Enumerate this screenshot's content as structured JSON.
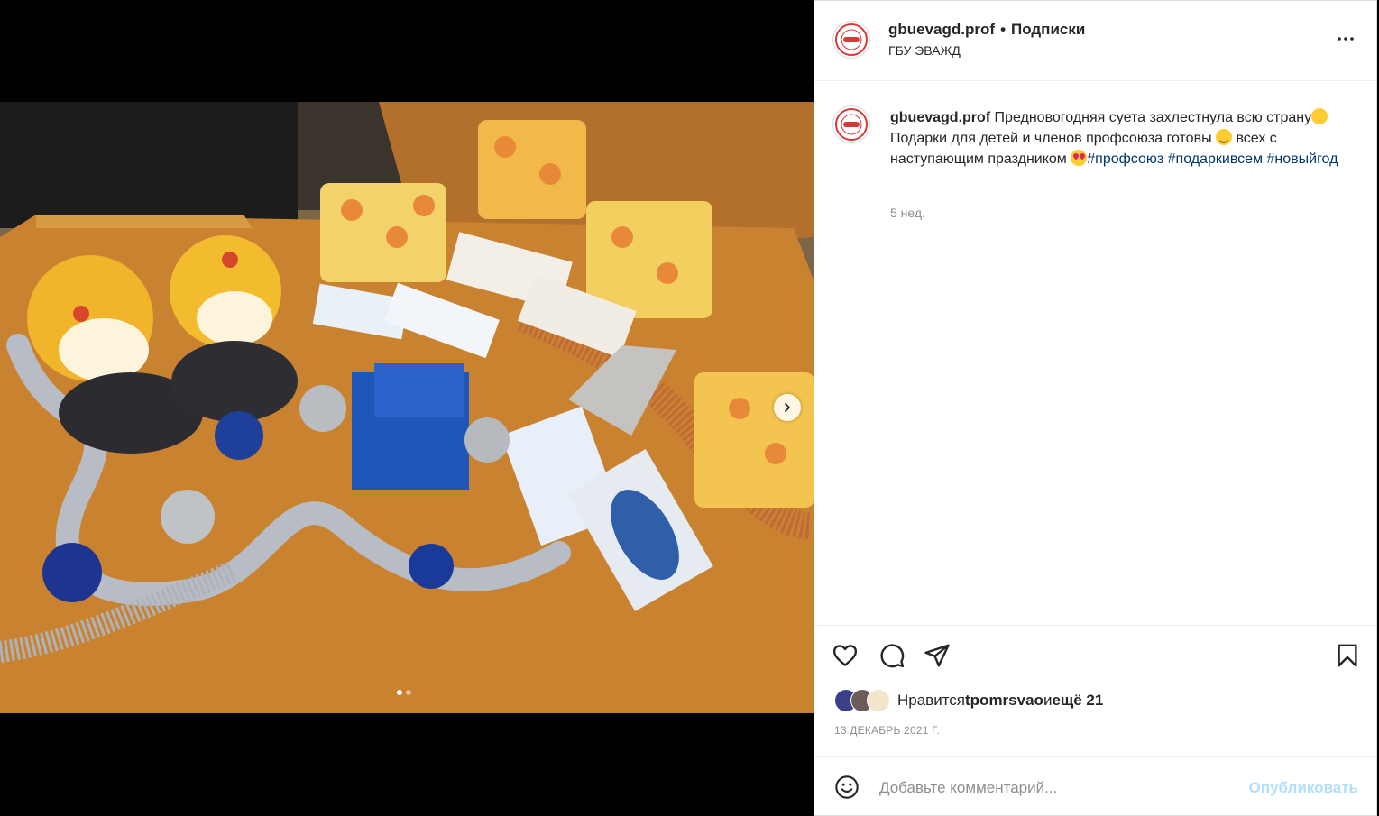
{
  "post": {
    "username": "gbuevagd.prof",
    "separator": "•",
    "follow_status": "Подписки",
    "location": "ГБУ ЭВАЖД",
    "caption_username": "gbuevagd.prof",
    "caption_part1": " Предновогодняя суета захлестнула всю страну",
    "caption_part2": " Подарки для детей и членов профсоюза готовы ",
    "caption_part3": " всех с наступающим праздником ",
    "hashtags": [
      "#профсоюз",
      "#подаркивсем",
      "#новыйгод"
    ],
    "time_ago": "5 нед.",
    "likes_prefix": "Нравится ",
    "likes_user": "tpomrsvao",
    "likes_and": " и ",
    "likes_more": "ещё 21",
    "date": "13 ДЕКАБРЬ 2021 Г.",
    "comment_placeholder": "Добавьте комментарий...",
    "publish_label": "Опубликовать",
    "carousel": {
      "current": 1,
      "total": 2
    }
  },
  "icons": {
    "more": "more-horizontal-icon",
    "like": "heart-icon",
    "comment": "comment-bubble-icon",
    "share": "paper-plane-icon",
    "save": "bookmark-icon",
    "emoji": "smiley-icon",
    "next": "chevron-right-icon"
  },
  "colors": {
    "hashtag": "#00376b",
    "publish_disabled": "#b2dffc",
    "muted": "#8e8e8e",
    "text": "#262626"
  }
}
